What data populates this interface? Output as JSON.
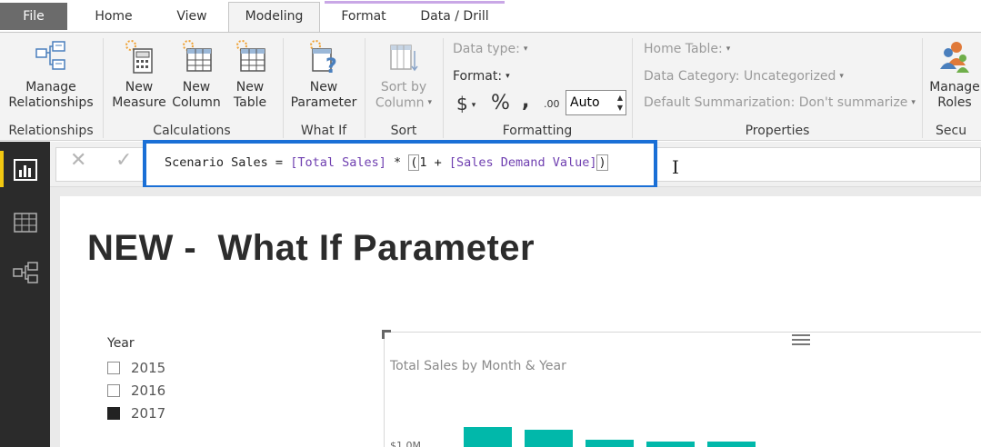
{
  "tabs": [
    {
      "label": "File"
    },
    {
      "label": "Home"
    },
    {
      "label": "View"
    },
    {
      "label": "Modeling"
    },
    {
      "label": "Format"
    },
    {
      "label": "Data / Drill"
    }
  ],
  "ribbon": {
    "relationships": {
      "manage_label": "Manage\nRelationships",
      "group_label": "Relationships"
    },
    "calculations": {
      "new_measure": "New\nMeasure",
      "new_column": "New\nColumn",
      "new_table": "New\nTable",
      "group_label": "Calculations"
    },
    "whatif": {
      "new_parameter": "New\nParameter",
      "group_label": "What If"
    },
    "sort": {
      "sort_by_column": "Sort by\nColumn",
      "group_label": "Sort"
    },
    "formatting": {
      "data_type": "Data type:",
      "format": "Format:",
      "currency_symbol": "$",
      "percent_symbol": "%",
      "comma_symbol": ",",
      "decimal_symbol": ".00",
      "auto_value": "Auto",
      "group_label": "Formatting"
    },
    "properties": {
      "home_table": "Home Table:",
      "data_category": "Data Category: Uncategorized",
      "default_summarization": "Default Summarization: Don't summarize",
      "group_label": "Properties"
    },
    "security": {
      "manage_roles": "Manage\nRoles",
      "group_label": "Secu"
    }
  },
  "formula": {
    "measure_name": "Scenario Sales",
    "equals": " = ",
    "ref1": "[Total Sales]",
    "op": " * ",
    "open_paren": "(",
    "one_plus": "1 + ",
    "ref2": "[Sales Demand Value]",
    "close_paren": ")"
  },
  "page": {
    "title": "NEW -  What If Parameter"
  },
  "slicer": {
    "title": "Year",
    "items": [
      {
        "label": "2015",
        "checked": false
      },
      {
        "label": "2016",
        "checked": false
      },
      {
        "label": "2017",
        "checked": true
      }
    ]
  },
  "chart_data": {
    "type": "bar",
    "title": "Total Sales by Month & Year",
    "y_tick_labels": [
      "$1.0M"
    ],
    "bar_color": "#01b8aa",
    "visible_bar_count": 5
  },
  "colors": {
    "accent_highlight": "#1a6fd6",
    "nav_active": "#f2c811",
    "bar": "#01b8aa"
  }
}
